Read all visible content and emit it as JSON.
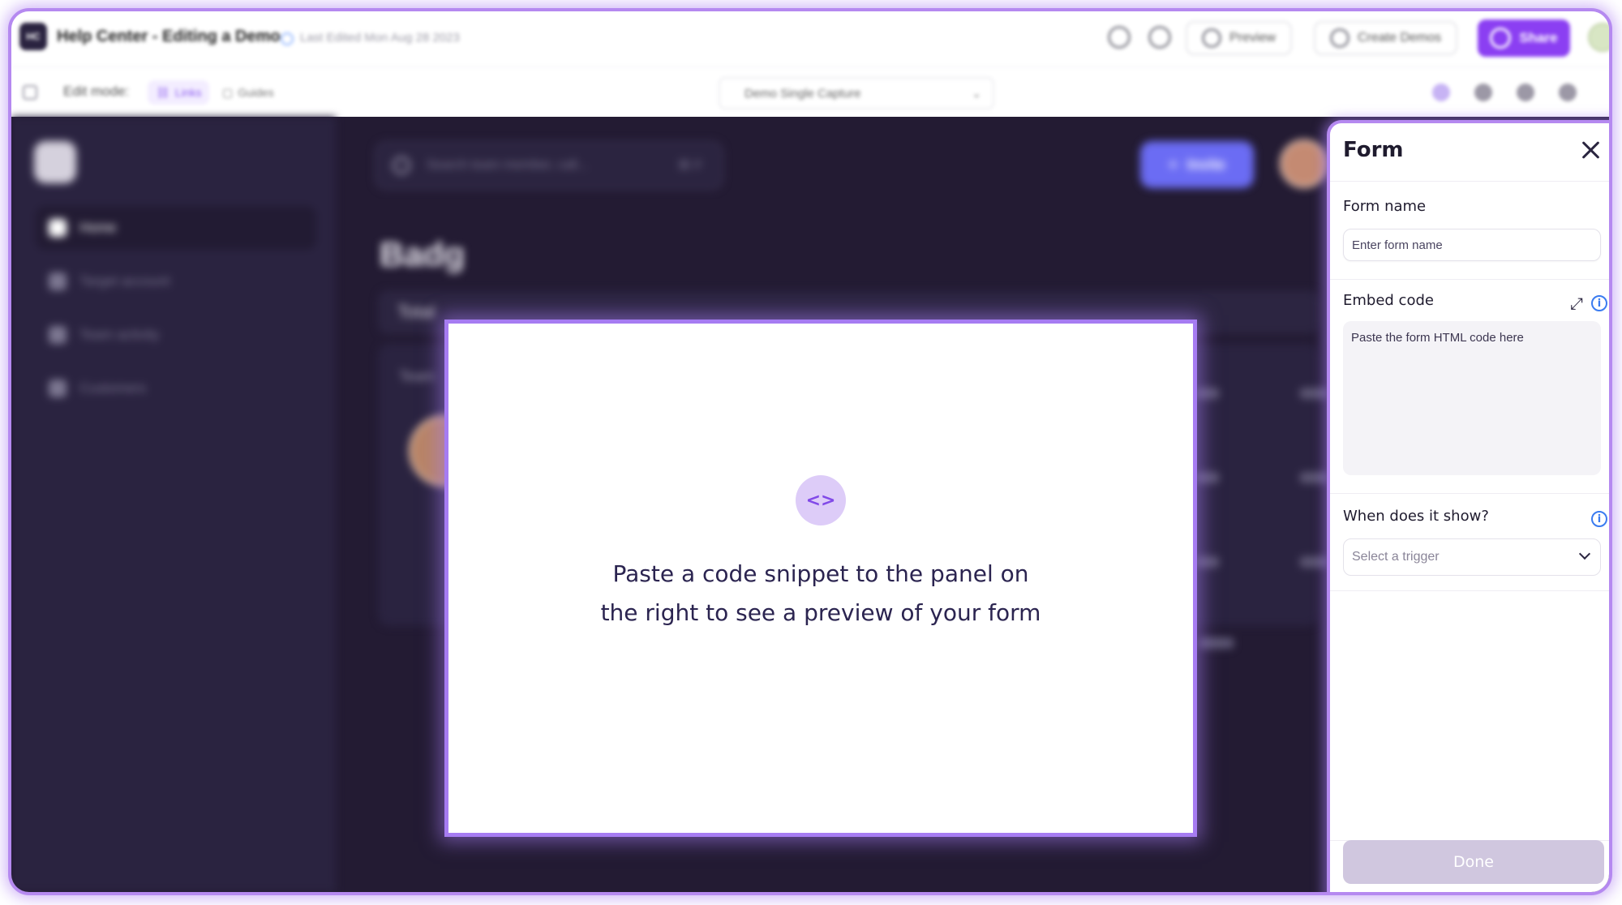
{
  "topbar": {
    "logo_text": "HC",
    "title": "Help Center - Editing a Demo",
    "last_edited": "Last Edited Mon Aug 28 2023",
    "preview_label": "Preview",
    "create_demos_label": "Create Demos",
    "share_label": "Share"
  },
  "subbar": {
    "edit_mode_label": "Edit mode:",
    "links_label": "Links",
    "guides_label": "Guides",
    "demo_select_value": "Demo Single Capture"
  },
  "app": {
    "sidebar_items": [
      {
        "label": "Home"
      },
      {
        "label": "Target account"
      },
      {
        "label": "Team activity"
      },
      {
        "label": "Customers"
      }
    ],
    "search_placeholder": "Search team member, call...",
    "search_shortcut": "⌘ F",
    "invite_label": "Invite",
    "page_title": "Badg",
    "card_label": "Total",
    "team_label": "Team"
  },
  "preview": {
    "icon": "code-icon",
    "message": "Paste a code snippet to the panel on the right to see a preview of your form"
  },
  "panel": {
    "title": "Form",
    "form_name_label": "Form name",
    "form_name_placeholder": "Enter form name",
    "embed_code_label": "Embed code",
    "embed_code_placeholder": "Paste the form HTML code here",
    "trigger_label": "When does it show?",
    "trigger_placeholder": "Select a trigger",
    "done_label": "Done"
  },
  "colors": {
    "accent": "#8b3ff2",
    "highlight_border": "#b589f0",
    "workspace_bg": "#231b33",
    "done_disabled": "#d0c7df",
    "info_blue": "#3a7bf0"
  }
}
